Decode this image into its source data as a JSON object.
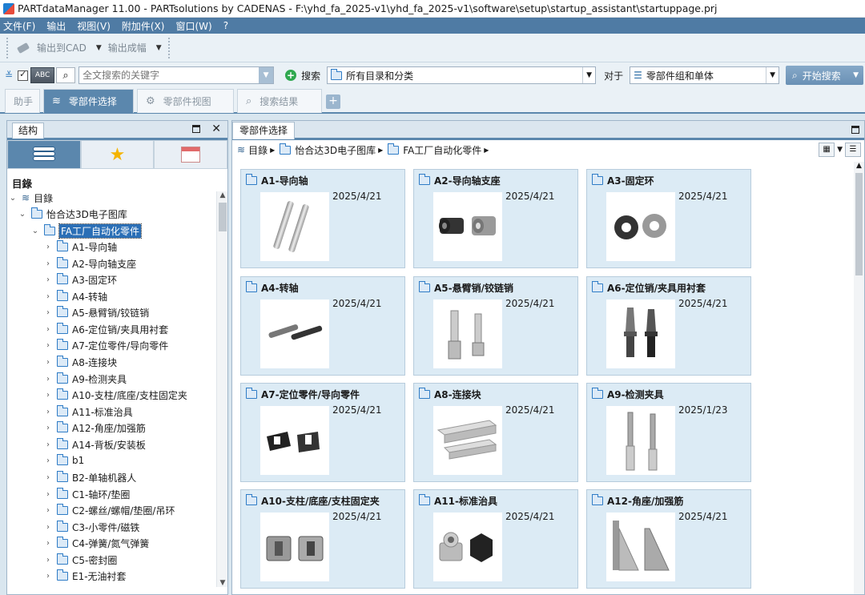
{
  "window": {
    "title": "PARTdataManager 11.00 - PARTsolutions by CADENAS - F:\\yhd_fa_2025-v1\\yhd_fa_2025-v1\\software\\setup\\startup_assistant\\startuppage.prj"
  },
  "menu": [
    "文件(F)",
    "输出",
    "视图(V)",
    "附加件(X)",
    "窗口(W)",
    "?"
  ],
  "toolbar": {
    "export_cad": "输出到CAD",
    "export_bom": "输出成幅"
  },
  "search": {
    "abc_label": "ABC",
    "placeholder": "全文搜索的关键字",
    "search_label": "搜索",
    "scope_value": "所有目录和分类",
    "for_label": "对于",
    "type_value": "零部件组和单体",
    "start_label": "开始搜索"
  },
  "tabs": [
    {
      "label": "助手"
    },
    {
      "label": "零部件选择"
    },
    {
      "label": "零部件视图"
    },
    {
      "label": "搜索结果"
    }
  ],
  "structure_panel": {
    "tab_label": "结构",
    "tree_title": "目錄",
    "tree": [
      {
        "label": "目錄"
      },
      {
        "label": "怡合达3D电子图库"
      },
      {
        "label": "FA工厂自动化零件"
      },
      {
        "label": "A1-导向轴"
      },
      {
        "label": "A2-导向轴支座"
      },
      {
        "label": "A3-固定环"
      },
      {
        "label": "A4-转轴"
      },
      {
        "label": "A5-悬臂销/铰链销"
      },
      {
        "label": "A6-定位销/夹具用衬套"
      },
      {
        "label": "A7-定位零件/导向零件"
      },
      {
        "label": "A8-连接块"
      },
      {
        "label": "A9-检测夹具"
      },
      {
        "label": "A10-支柱/底座/支柱固定夹"
      },
      {
        "label": "A11-标准治具"
      },
      {
        "label": "A12-角座/加强筋"
      },
      {
        "label": "A14-背板/安装板"
      },
      {
        "label": "b1"
      },
      {
        "label": "B2-单轴机器人"
      },
      {
        "label": "C1-轴环/垫圈"
      },
      {
        "label": "C2-螺丝/螺帽/垫圈/吊环"
      },
      {
        "label": "C3-小零件/磁铁"
      },
      {
        "label": "C4-弹簧/氮气弹簧"
      },
      {
        "label": "C5-密封圈"
      },
      {
        "label": "E1-无油衬套"
      }
    ]
  },
  "content_panel": {
    "tab_label": "零部件选择",
    "breadcrumb": [
      "目錄",
      "怡合达3D电子图库",
      "FA工厂自动化零件"
    ],
    "cards": [
      {
        "title": "A1-导向轴",
        "date": "2025/4/21"
      },
      {
        "title": "A2-导向轴支座",
        "date": "2025/4/21"
      },
      {
        "title": "A3-固定环",
        "date": "2025/4/21"
      },
      {
        "title": "A4-转轴",
        "date": "2025/4/21"
      },
      {
        "title": "A5-悬臂销/铰链销",
        "date": "2025/4/21"
      },
      {
        "title": "A6-定位销/夹具用衬套",
        "date": "2025/4/21"
      },
      {
        "title": "A7-定位零件/导向零件",
        "date": "2025/4/21"
      },
      {
        "title": "A8-连接块",
        "date": "2025/4/21"
      },
      {
        "title": "A9-检测夹具",
        "date": "2025/1/23"
      },
      {
        "title": "A10-支柱/底座/支柱固定夹",
        "date": "2025/4/21"
      },
      {
        "title": "A11-标准治具",
        "date": "2025/4/21"
      },
      {
        "title": "A12-角座/加强筋",
        "date": "2025/4/21"
      }
    ]
  },
  "colors": {
    "menubar": "#4f7ba4",
    "accent": "#5b87ad",
    "card_bg": "#dcebf5",
    "selection": "#2b6fb6"
  }
}
